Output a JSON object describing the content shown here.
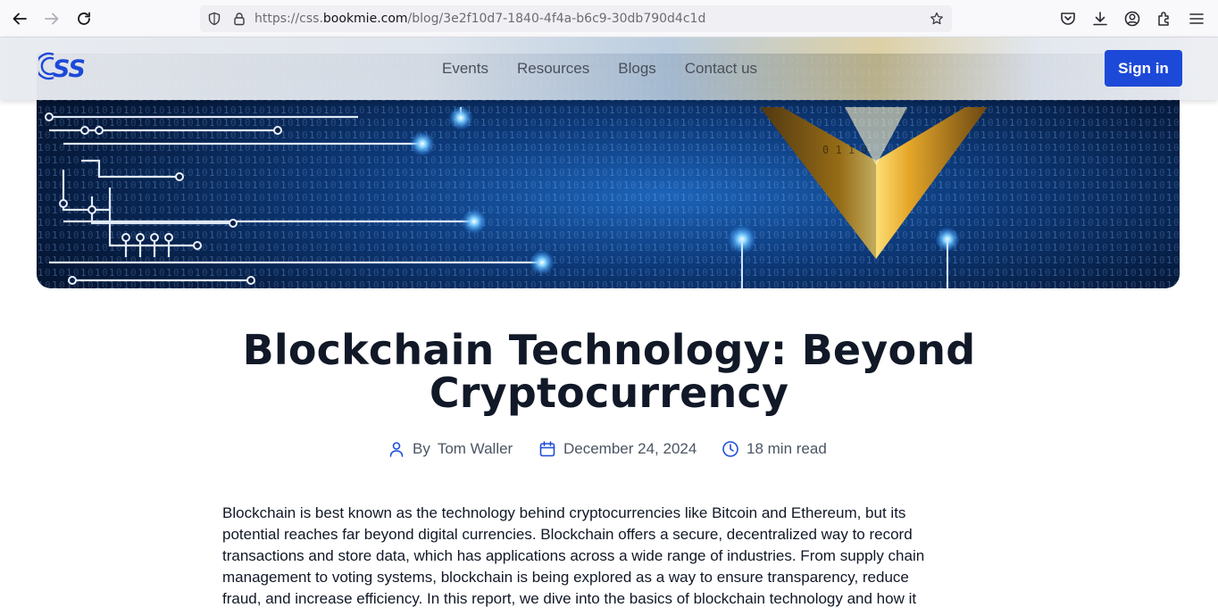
{
  "browser": {
    "url_prefix": "https://css.",
    "url_host": "bookmie.com",
    "url_path": "/blog/3e2f10d7-1840-4f4a-b6c9-30db790d4c1d"
  },
  "site": {
    "logo_text": "CSS",
    "nav": [
      "Events",
      "Resources",
      "Blogs",
      "Contact us"
    ],
    "signin_label": "Sign in",
    "brand_color": "#1d49d8"
  },
  "article": {
    "title_line1": "Blockchain Technology: Beyond",
    "title_line2": "Cryptocurrency",
    "by_label": "By",
    "author": "Tom Waller",
    "date": "December 24, 2024",
    "read_time": "18 min read",
    "body_lines": [
      "Blockchain is best known as the technology behind cryptocurrencies like Bitcoin and Ethereum, but its",
      "potential reaches far beyond digital currencies. Blockchain offers a secure, decentralized way to record",
      "transactions and store data, which has applications across a wide range of industries. From supply chain",
      "management to voting systems, blockchain is being explored as a way to ensure transparency, reduce",
      "fraud, and increase efficiency. In this report, we dive into the basics of blockchain technology and how it"
    ]
  }
}
